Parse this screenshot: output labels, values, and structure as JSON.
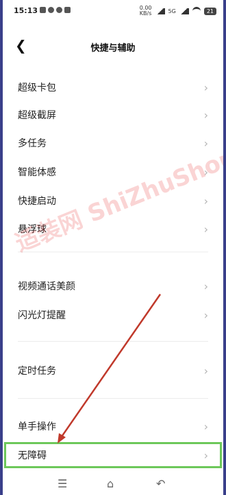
{
  "status_bar": {
    "time": "15:13",
    "speed_top": "0.00",
    "speed_bottom": "KB/s",
    "network": "5G",
    "battery": "21"
  },
  "header": {
    "title": "快捷与辅助"
  },
  "items": [
    {
      "label": "超级卡包"
    },
    {
      "label": "超级截屏"
    },
    {
      "label": "多任务"
    },
    {
      "label": "智能体感"
    },
    {
      "label": "快捷启动"
    },
    {
      "label": "悬浮球"
    },
    {
      "label": "视频通话美颜"
    },
    {
      "label": "闪光灯提醒"
    },
    {
      "label": "定时任务"
    },
    {
      "label": "单手操作"
    },
    {
      "label": "无障碍"
    }
  ],
  "watermark": {
    "text": "适装网 ShiZhuShou.Com"
  },
  "colors": {
    "highlight": "#6dc85a",
    "arrow": "#c0392b",
    "watermark": "#e63c3c"
  }
}
